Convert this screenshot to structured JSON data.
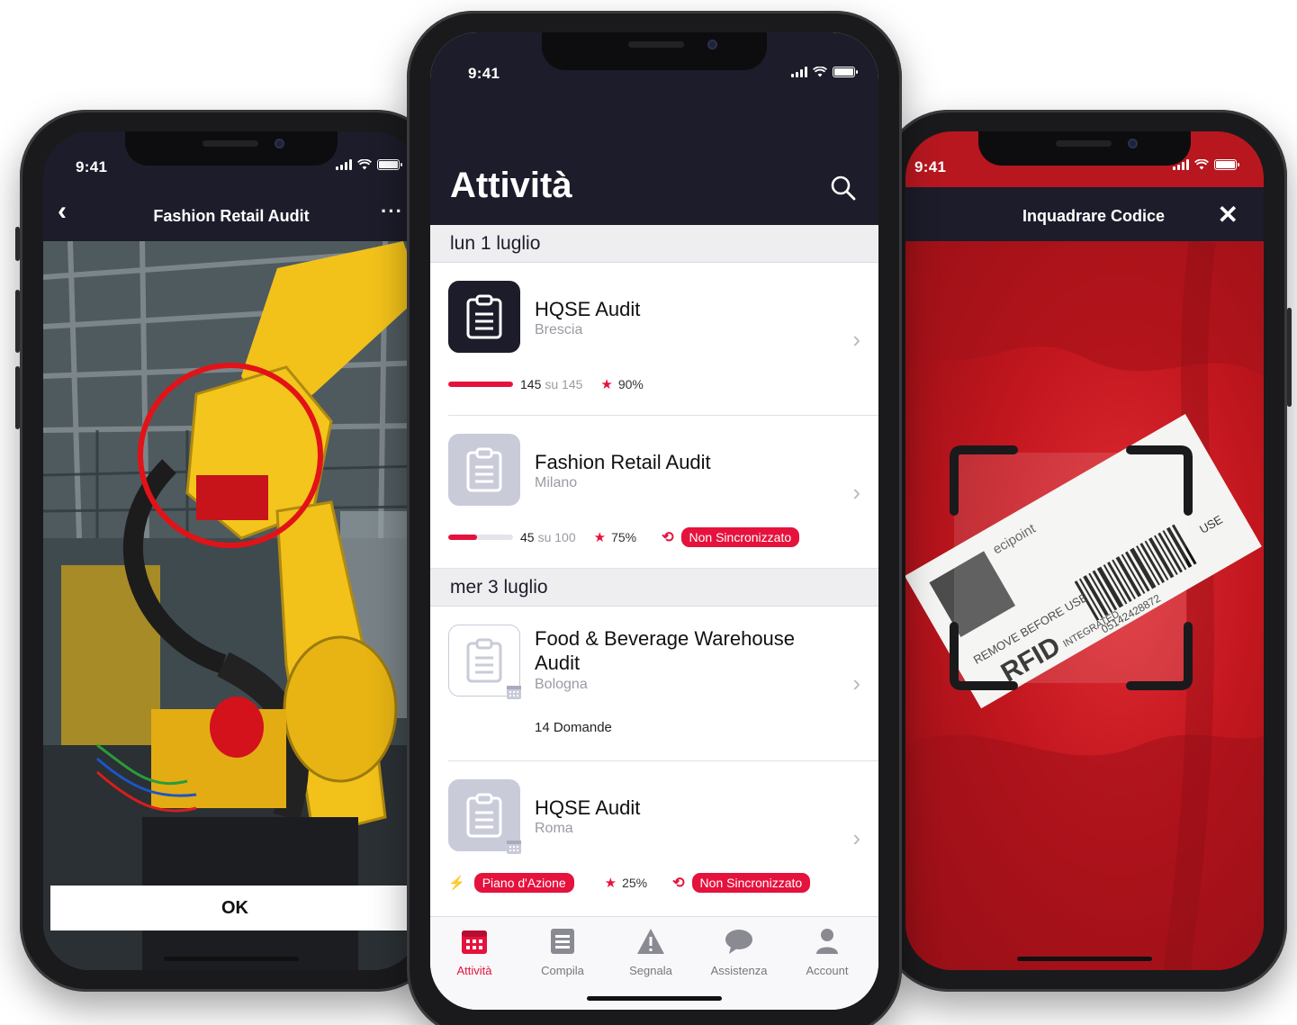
{
  "status_time": "9:41",
  "left_screen": {
    "title": "Fashion Retail Audit",
    "ok_label": "OK"
  },
  "right_screen": {
    "title": "Inquadrare Codice"
  },
  "center_screen": {
    "title": "Attività",
    "groups": [
      {
        "date": "lun 1 luglio",
        "items": [
          {
            "title": "HQSE Audit",
            "subtitle": "Brescia",
            "done": "145",
            "total": "su 145",
            "progress": 1.0,
            "score": "90%",
            "sync_badge": ""
          },
          {
            "title": "Fashion Retail Audit",
            "subtitle": "Milano",
            "done": "45",
            "total": "su 100",
            "progress": 0.45,
            "score": "75%",
            "sync_badge": "Non Sincronizzato"
          }
        ]
      },
      {
        "date": "mer 3 luglio",
        "items": [
          {
            "title": "Food & Beverage Warehouse Audit",
            "subtitle": "Bologna",
            "questions": "14 Domande"
          },
          {
            "title": "HQSE Audit",
            "subtitle": "Roma",
            "action_badge": "Piano d'Azione",
            "score": "25%",
            "sync_badge": "Non Sincronizzato"
          }
        ]
      }
    ],
    "tabs": [
      {
        "label": "Attività",
        "icon": "calendar-icon",
        "active": true
      },
      {
        "label": "Compila",
        "icon": "form-icon",
        "active": false
      },
      {
        "label": "Segnala",
        "icon": "warning-icon",
        "active": false
      },
      {
        "label": "Assistenza",
        "icon": "chat-icon",
        "active": false
      },
      {
        "label": "Account",
        "icon": "user-icon",
        "active": false
      }
    ]
  },
  "colors": {
    "accent": "#e5123d",
    "header_bg": "#1c1c2a",
    "date_row_bg": "#eeeef1"
  },
  "label_text": {
    "tag_top": "REMOVE BEFORE USE",
    "tag_main": "RFID",
    "tag_sub": "INTEGRATED",
    "tag_code": "05142428872",
    "tag_side": "USE",
    "tag_brand": "ecipoint"
  }
}
